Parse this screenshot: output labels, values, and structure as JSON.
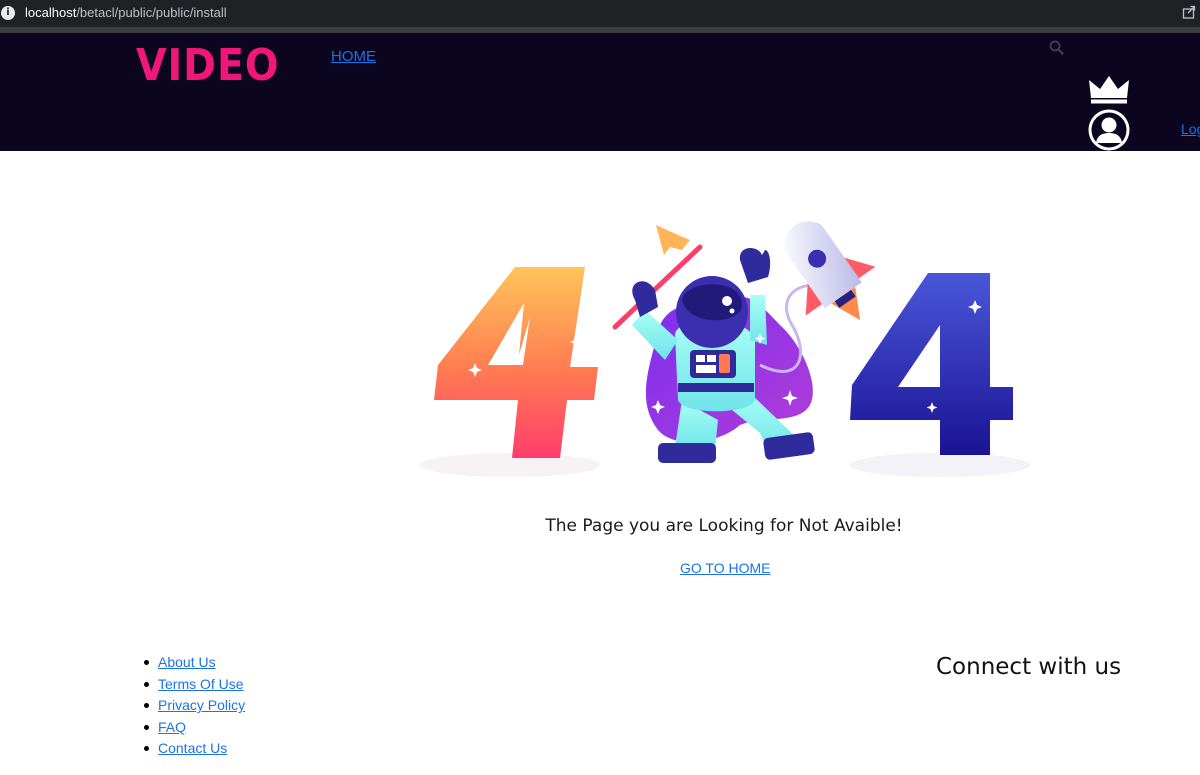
{
  "browser": {
    "url_host": "localhost",
    "url_path": "/betacl/public/public/install"
  },
  "header": {
    "logo": "VIDEO",
    "nav_home": "HOME",
    "login": "Log",
    "icons": [
      "search-icon",
      "crown-icon",
      "user-avatar-icon"
    ]
  },
  "error": {
    "digit_left": "4",
    "digit_right": "4",
    "message": "The Page you are Looking for Not Avaible!",
    "go_home": "GO TO HOME"
  },
  "footer": {
    "links": [
      "About Us",
      "Terms Of Use",
      "Privacy Policy",
      "FAQ",
      "Contact Us"
    ],
    "connect_title": "Connect with us"
  },
  "colors": {
    "header_bg": "#0c0520",
    "logo": "#f0167a",
    "link": "#1a73e8"
  }
}
